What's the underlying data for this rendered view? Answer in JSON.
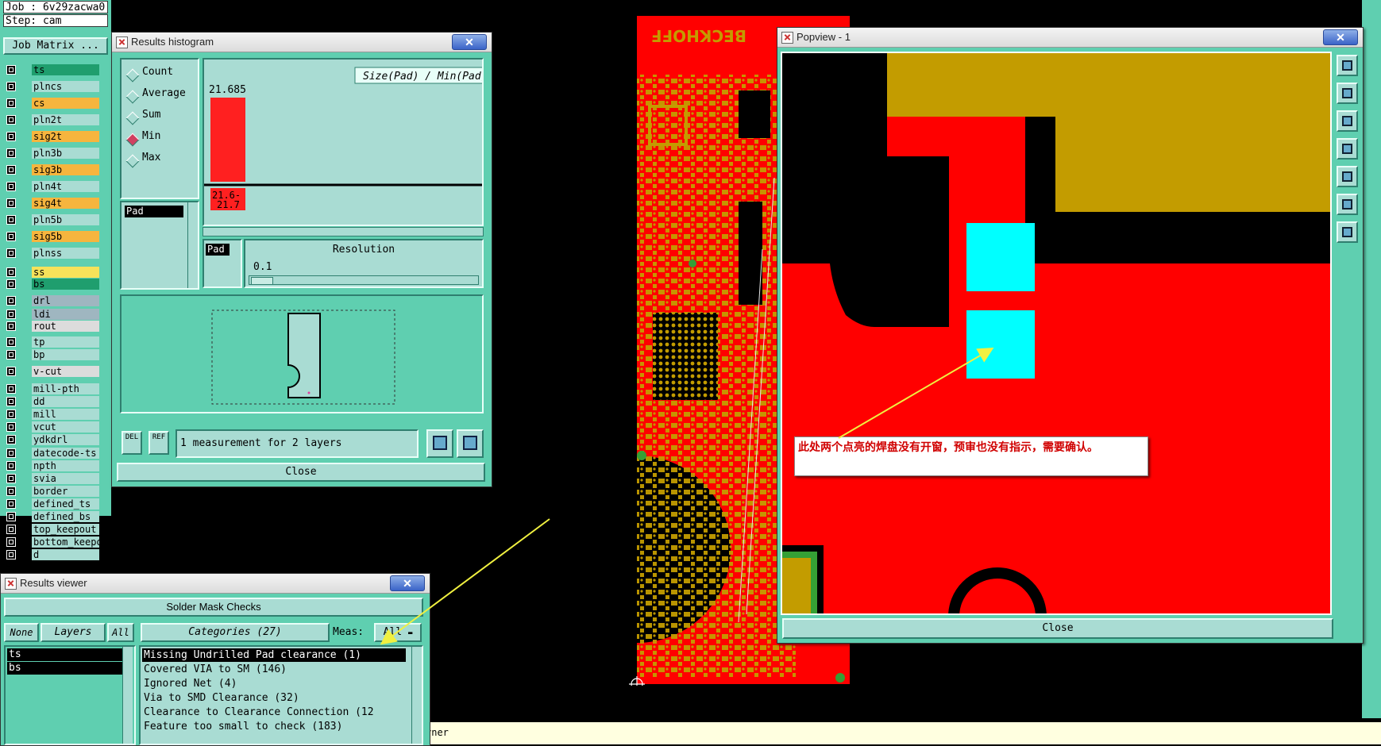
{
  "job_panel": {
    "job_label": "Job : 6v29zacwa0",
    "step_label": "Step: cam",
    "matrix_button": "Job Matrix ..."
  },
  "layers": [
    {
      "name": "ts",
      "color": "#1f9e6e"
    },
    {
      "name": "plncs",
      "color": "#a9dcd3"
    },
    {
      "name": "cs",
      "color": "#f6b53e"
    },
    {
      "name": "pln2t",
      "color": "#a9dcd3"
    },
    {
      "name": "sig2t",
      "color": "#f6b53e"
    },
    {
      "name": "pln3b",
      "color": "#a9dcd3"
    },
    {
      "name": "sig3b",
      "color": "#f6b53e"
    },
    {
      "name": "pln4t",
      "color": "#a9dcd3"
    },
    {
      "name": "sig4t",
      "color": "#f6b53e"
    },
    {
      "name": "pln5b",
      "color": "#a9dcd3"
    },
    {
      "name": "sig5b",
      "color": "#f6b53e"
    },
    {
      "name": "plnss",
      "color": "#a9dcd3"
    },
    {
      "name": "ss",
      "color": "#f6e25a"
    },
    {
      "name": "bs",
      "color": "#1f9e6e"
    },
    {
      "name": "drl",
      "color": "#9fb6c0"
    },
    {
      "name": "ldi",
      "color": "#9fb6c0"
    },
    {
      "name": "rout",
      "color": "#dcdcdc"
    },
    {
      "name": "tp",
      "color": "#a9dcd3"
    },
    {
      "name": "bp",
      "color": "#a9dcd3"
    },
    {
      "name": "v-cut",
      "color": "#dcdcdc"
    },
    {
      "name": "mill-pth",
      "color": "#a9dcd3"
    },
    {
      "name": "dd",
      "color": "#a9dcd3"
    },
    {
      "name": "mill",
      "color": "#a9dcd3"
    },
    {
      "name": "vcut",
      "color": "#a9dcd3"
    },
    {
      "name": "ydkdrl",
      "color": "#a9dcd3"
    },
    {
      "name": "datecode-ts",
      "color": "#a9dcd3"
    },
    {
      "name": "npth",
      "color": "#a9dcd3"
    },
    {
      "name": "svia",
      "color": "#a9dcd3"
    },
    {
      "name": "border",
      "color": "#a9dcd3"
    },
    {
      "name": "defined_ts",
      "color": "#a9dcd3"
    },
    {
      "name": "defined_bs",
      "color": "#a9dcd3"
    },
    {
      "name": "top_keepout",
      "color": "#a9dcd3"
    },
    {
      "name": "bottom_keepout",
      "color": "#a9dcd3"
    },
    {
      "name": "d",
      "color": "#a9dcd3"
    }
  ],
  "histogram": {
    "window_title": "Results histogram",
    "close_x": "✕",
    "options": [
      "Count",
      "Average",
      "Sum",
      "Min",
      "Max"
    ],
    "selected_option": "Min",
    "list_item": "Pad",
    "del_label": "DEL",
    "ref_label": "REF",
    "chart_title": "Size(Pad) / Min(Pad)",
    "bar_value_label": "21.685",
    "bin_label_1": "21.6-",
    "bin_label_2": "21.7",
    "axis_item": "Pad",
    "resolution_label": "Resolution",
    "resolution_value": "0.1",
    "measurement_text": "1 measurement for 2 layers",
    "close_button": "Close"
  },
  "results_viewer": {
    "window_title": "Results viewer",
    "close_x": "✕",
    "header": "Solder Mask Checks",
    "none_button": "None",
    "layers_button": "Layers",
    "all_button": "All",
    "categories_button": "Categories (27)",
    "meas_label": "Meas:",
    "meas_value": "All",
    "layer_items": [
      "ts",
      "bs"
    ],
    "categories": [
      "Missing Undrilled Pad clearance (1)",
      "Covered VIA to SM (146)",
      "Ignored Net (4)",
      "Via to SMD Clearance (32)",
      "Clearance to Clearance Connection (12",
      "Feature too small to check (183)"
    ],
    "selected_category": "Missing Undrilled Pad clearance (1)"
  },
  "status_bar_text": "rner",
  "popview": {
    "window_title": "Popview - 1",
    "close_x": "✕",
    "close_button": "Close",
    "toolbar_icons": [
      "zoom-home-icon",
      "move-up-icon",
      "move-down-icon",
      "move-left-icon",
      "move-right-icon",
      "zoom-fit-icon",
      "zoom-area-icon"
    ]
  },
  "annotation_text": "此处两个点亮的焊盘没有开窗，预审也没有指示，需要确认。",
  "colors": {
    "teal": "#5fcfb0",
    "panel": "#a9dcd3",
    "copper_red": "#ff0000",
    "gold": "#c39c00",
    "cyan": "#00ffff",
    "arrow": "#f0f040"
  }
}
